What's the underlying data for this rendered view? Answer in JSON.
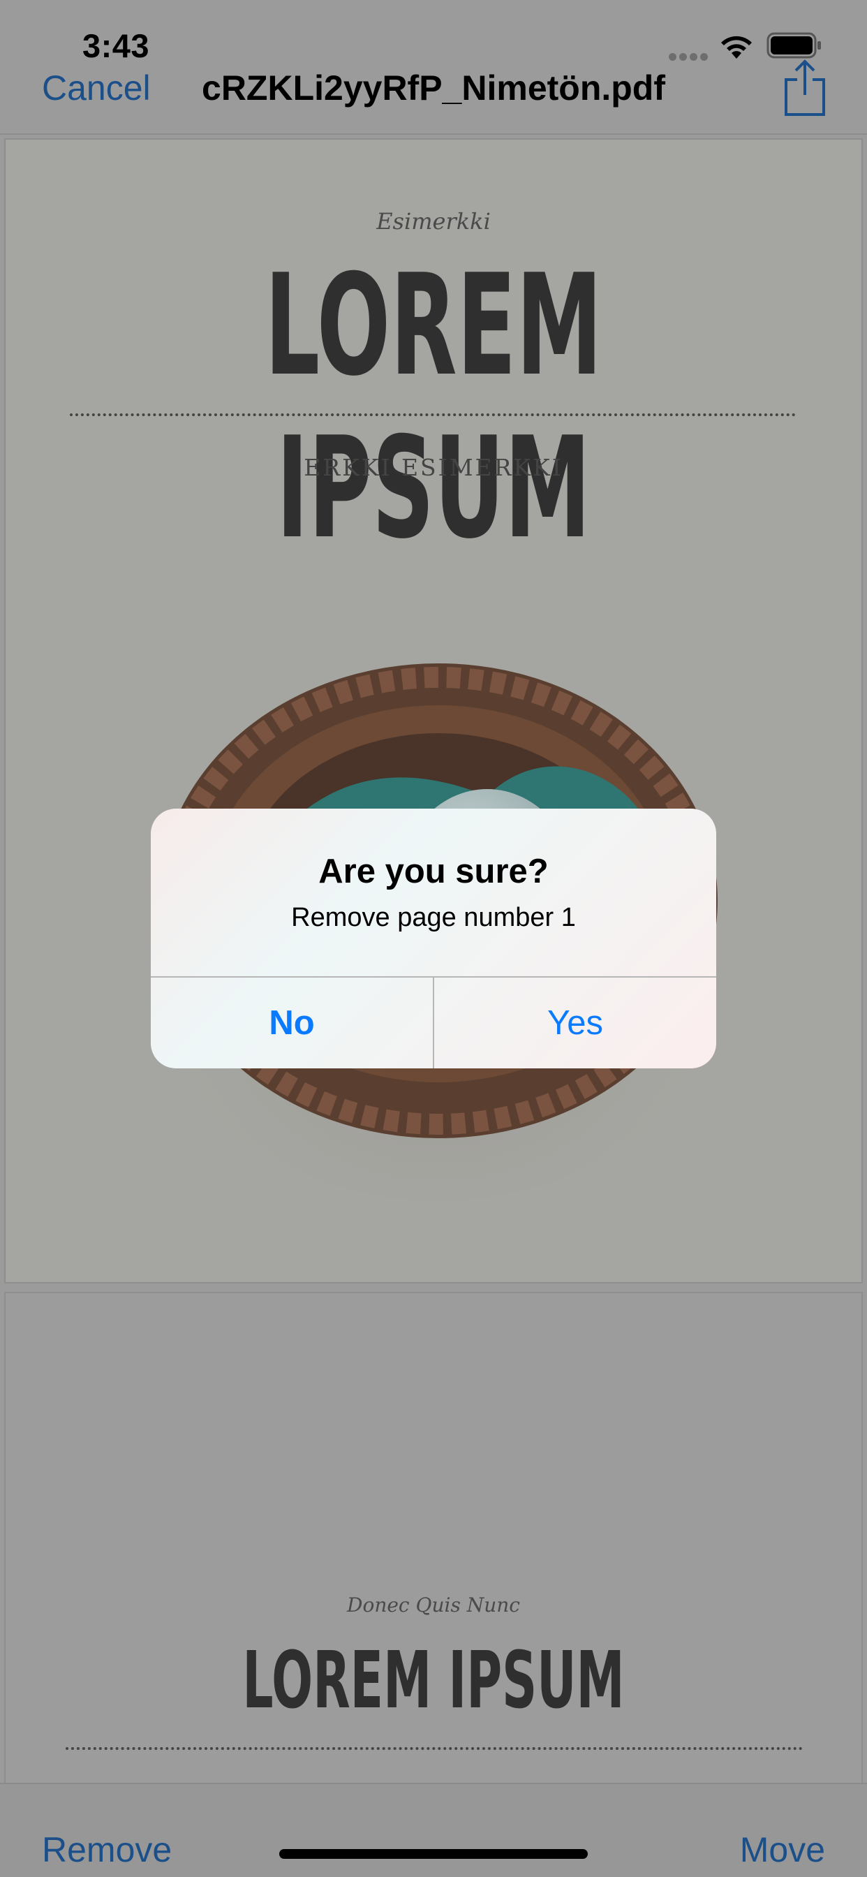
{
  "status_bar": {
    "time": "3:43"
  },
  "nav": {
    "cancel_label": "Cancel",
    "title": "cRZKLi2yyRfP_Nimetön.pdf",
    "share_icon": "share-icon"
  },
  "pages": [
    {
      "subtitle": "Esimerkki",
      "heading": "LOREM IPSUM",
      "author": "ERKKI ESIMERKKI",
      "image": "bird-nest-with-eggs"
    },
    {
      "subtitle": "Donec Quis Nunc",
      "heading": "LOREM IPSUM"
    }
  ],
  "alert": {
    "title": "Are you sure?",
    "message": "Remove page number 1",
    "no_label": "No",
    "yes_label": "Yes",
    "button_color": "#0a7aff"
  },
  "toolbar": {
    "remove_label": "Remove",
    "move_label": "Move",
    "accent_color": "#1b4f8a"
  }
}
